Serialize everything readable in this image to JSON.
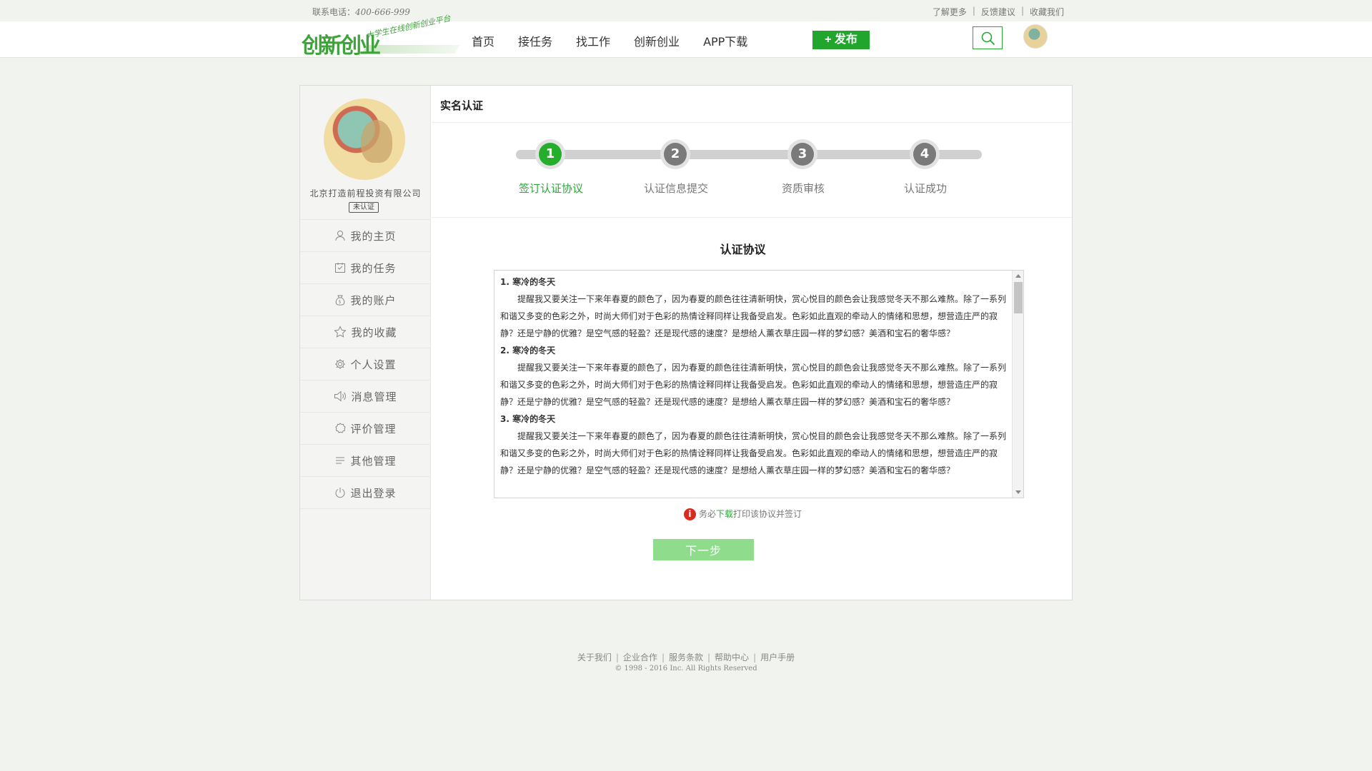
{
  "topbar": {
    "phone_label": "联系电话：",
    "phone_number": "400-666-999",
    "links": [
      "了解更多",
      "反馈建议",
      "收藏我们"
    ]
  },
  "header": {
    "logo_text": "创新创业",
    "logo_slogan": "大学生在线创新创业平台",
    "nav": [
      "首页",
      "接任务",
      "找工作",
      "创新创业",
      "APP下载"
    ],
    "publish_label": "+ 发布",
    "accent_color": "#22a52c"
  },
  "sidebar": {
    "company": "北京打造前程投资有限公司",
    "badge": "未认证",
    "menu": [
      {
        "label": "我的主页",
        "icon": "user-icon"
      },
      {
        "label": "我的任务",
        "icon": "task-icon"
      },
      {
        "label": "我的账户",
        "icon": "money-bag-icon"
      },
      {
        "label": "我的收藏",
        "icon": "star-icon"
      },
      {
        "label": "个人设置",
        "icon": "gear-icon"
      },
      {
        "label": "消息管理",
        "icon": "speaker-icon"
      },
      {
        "label": "评价管理",
        "icon": "badge-icon"
      },
      {
        "label": "其他管理",
        "icon": "menu-icon"
      },
      {
        "label": "退出登录",
        "icon": "power-icon"
      }
    ]
  },
  "content": {
    "title": "实名认证",
    "steps": [
      {
        "num": "1",
        "label": "签订认证协议",
        "active": true
      },
      {
        "num": "2",
        "label": "认证信息提交",
        "active": false
      },
      {
        "num": "3",
        "label": "资质审核",
        "active": false
      },
      {
        "num": "4",
        "label": "认证成功",
        "active": false
      }
    ],
    "agreement_title": "认证协议",
    "sections": [
      {
        "heading": "1. 寒冷的冬天",
        "body": "提醒我又要关注一下来年春夏的颜色了，因为春夏的颜色往往清新明快，赏心悦目的颜色会让我感觉冬天不那么难熬。除了一系列和谐又多变的色彩之外，时尚大师们对于色彩的热情诠释同样让我备受启发。色彩如此直观的牵动人的情绪和思想，想营造庄严的寂静？还是宁静的优雅？是空气感的轻盈？还是现代感的速度？是想给人薰衣草庄园一样的梦幻感？美酒和宝石的奢华感？"
      },
      {
        "heading": "2. 寒冷的冬天",
        "body": "提醒我又要关注一下来年春夏的颜色了，因为春夏的颜色往往清新明快，赏心悦目的颜色会让我感觉冬天不那么难熬。除了一系列和谐又多变的色彩之外，时尚大师们对于色彩的热情诠释同样让我备受启发。色彩如此直观的牵动人的情绪和思想，想营造庄严的寂静？还是宁静的优雅？是空气感的轻盈？还是现代感的速度？是想给人薰衣草庄园一样的梦幻感？美酒和宝石的奢华感？"
      },
      {
        "heading": "3. 寒冷的冬天",
        "body": "提醒我又要关注一下来年春夏的颜色了，因为春夏的颜色往往清新明快，赏心悦目的颜色会让我感觉冬天不那么难熬。除了一系列和谐又多变的色彩之外，时尚大师们对于色彩的热情诠释同样让我备受启发。色彩如此直观的牵动人的情绪和思想，想营造庄严的寂静？还是宁静的优雅？是空气感的轻盈？还是现代感的速度？是想给人薰衣草庄园一样的梦幻感？美酒和宝石的奢华感？"
      }
    ],
    "notice_prefix": "务必",
    "notice_link": "下载",
    "notice_suffix": "打印该协议并签订",
    "next_label": "下一步"
  },
  "footer": {
    "links": [
      "关于我们",
      "企业合作",
      "服务条款",
      "帮助中心",
      "用户手册"
    ],
    "copyright": "© 1998 - 2016  Inc. All Rights Reserved"
  }
}
